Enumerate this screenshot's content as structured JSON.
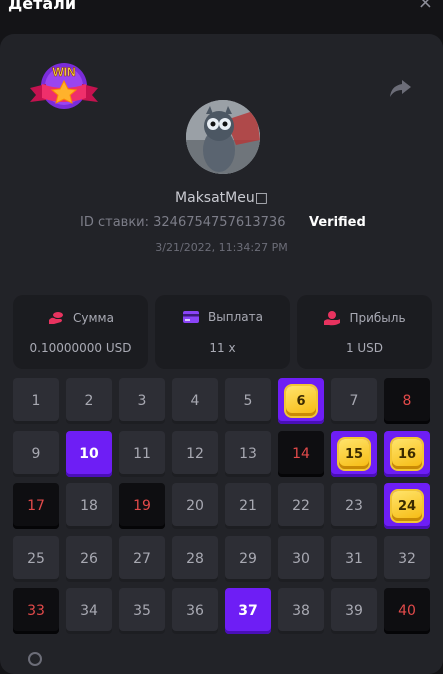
{
  "header": {
    "title": "Детали",
    "close_glyph": "×"
  },
  "player": {
    "username": "MaksatMeu□",
    "bet_id_text": "ID ставки: 3246754757613736",
    "verified_label": "Verified",
    "datetime": "3/21/2022, 11:34:27 PM",
    "badge_text": "WIN"
  },
  "stats": [
    {
      "label": "Сумма",
      "value": "0.10000000 USD",
      "icon": "coins-icon"
    },
    {
      "label": "Выплата",
      "value": "11 x",
      "icon": "card-icon"
    },
    {
      "label": "Прибыль",
      "value": "1 USD",
      "icon": "hand-coin-icon"
    }
  ],
  "colors": {
    "accent": "#6e1ef5",
    "gem": "#f6c21c",
    "miss_text": "#e24a4a",
    "cell": "#2d2e35",
    "panel": "#222328"
  },
  "board": {
    "columns": 8,
    "cells": [
      {
        "n": "1",
        "state": "normal"
      },
      {
        "n": "2",
        "state": "normal"
      },
      {
        "n": "3",
        "state": "normal"
      },
      {
        "n": "4",
        "state": "normal"
      },
      {
        "n": "5",
        "state": "normal"
      },
      {
        "n": "6",
        "state": "hit"
      },
      {
        "n": "7",
        "state": "normal"
      },
      {
        "n": "8",
        "state": "miss"
      },
      {
        "n": "9",
        "state": "normal"
      },
      {
        "n": "10",
        "state": "pick"
      },
      {
        "n": "11",
        "state": "normal"
      },
      {
        "n": "12",
        "state": "normal"
      },
      {
        "n": "13",
        "state": "normal"
      },
      {
        "n": "14",
        "state": "miss"
      },
      {
        "n": "15",
        "state": "hit"
      },
      {
        "n": "16",
        "state": "hit"
      },
      {
        "n": "17",
        "state": "miss"
      },
      {
        "n": "18",
        "state": "normal"
      },
      {
        "n": "19",
        "state": "miss"
      },
      {
        "n": "20",
        "state": "normal"
      },
      {
        "n": "21",
        "state": "normal"
      },
      {
        "n": "22",
        "state": "normal"
      },
      {
        "n": "23",
        "state": "normal"
      },
      {
        "n": "24",
        "state": "hit"
      },
      {
        "n": "25",
        "state": "normal"
      },
      {
        "n": "26",
        "state": "normal"
      },
      {
        "n": "27",
        "state": "normal"
      },
      {
        "n": "28",
        "state": "normal"
      },
      {
        "n": "29",
        "state": "normal"
      },
      {
        "n": "30",
        "state": "normal"
      },
      {
        "n": "31",
        "state": "normal"
      },
      {
        "n": "32",
        "state": "normal"
      },
      {
        "n": "33",
        "state": "miss"
      },
      {
        "n": "34",
        "state": "normal"
      },
      {
        "n": "35",
        "state": "normal"
      },
      {
        "n": "36",
        "state": "normal"
      },
      {
        "n": "37",
        "state": "pick"
      },
      {
        "n": "38",
        "state": "normal"
      },
      {
        "n": "39",
        "state": "normal"
      },
      {
        "n": "40",
        "state": "miss"
      }
    ]
  }
}
